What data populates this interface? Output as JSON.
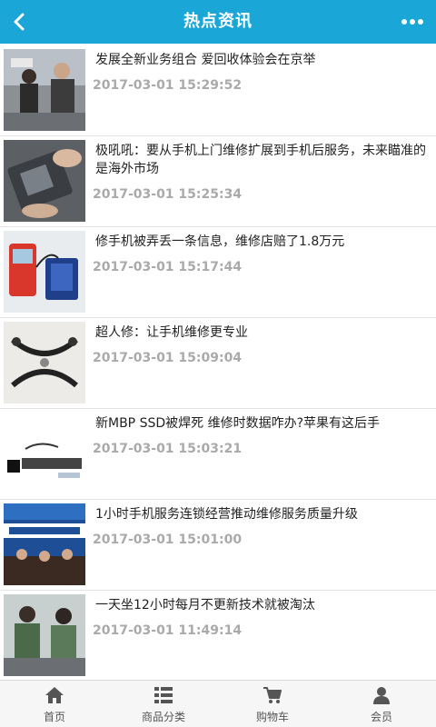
{
  "header": {
    "title": "热点资讯"
  },
  "news": [
    {
      "title": "发展全新业务组合 爱回收体验会在京举",
      "date": "2017-03-01 15:29:52"
    },
    {
      "title": "极吼吼：要从手机上门维修扩展到手机后服务，未来瞄准的是海外市场",
      "date": "2017-03-01 15:25:34"
    },
    {
      "title": "修手机被弄丢一条信息，维修店赔了1.8万元",
      "date": "2017-03-01 15:17:44"
    },
    {
      "title": "超人修：让手机维修更专业",
      "date": "2017-03-01 15:09:04"
    },
    {
      "title": "新MBP SSD被焊死 维修时数据咋办?苹果有这后手",
      "date": "2017-03-01 15:03:21"
    },
    {
      "title": "1小时手机服务连锁经营推动维修服务质量升级",
      "date": "2017-03-01 15:01:00"
    },
    {
      "title": "一天坐12小时每月不更新技术就被淘汰",
      "date": "2017-03-01 11:49:14"
    }
  ],
  "tabbar": [
    {
      "label": "首页",
      "icon": "home-icon"
    },
    {
      "label": "商品分类",
      "icon": "list-icon"
    },
    {
      "label": "购物车",
      "icon": "cart-icon"
    },
    {
      "label": "会员",
      "icon": "user-icon"
    }
  ],
  "colors": {
    "header_bg": "#1aa7d8",
    "date_text": "#aaaaaa"
  }
}
